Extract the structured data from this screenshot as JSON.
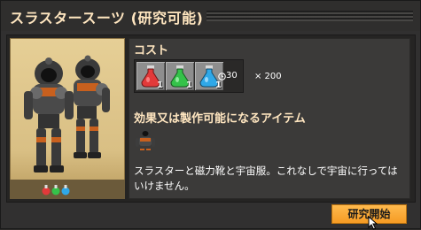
{
  "window": {
    "title": "スラスタースーツ (研究可能)"
  },
  "cost": {
    "label": "コスト",
    "ingredients": [
      {
        "name": "red-science-pack-icon",
        "count": "1",
        "color": "#e23a3a"
      },
      {
        "name": "green-science-pack-icon",
        "count": "1",
        "color": "#35c24a"
      },
      {
        "name": "blue-science-pack-icon",
        "count": "1",
        "color": "#2fa8e8"
      }
    ],
    "time": "30",
    "multiplier": "× 200"
  },
  "effects": {
    "label": "効果又は製作可能になるアイテム",
    "unlocks": [
      {
        "name": "thruster-suit-icon"
      }
    ]
  },
  "description": "スラスターと磁力靴と宇宙服。これなしで宇宙に行ってはいけません。",
  "button": {
    "label": "研究開始"
  },
  "colors": {
    "accent": "#f59a22",
    "title": "#ffe6c0",
    "card": "#dcc38a"
  }
}
